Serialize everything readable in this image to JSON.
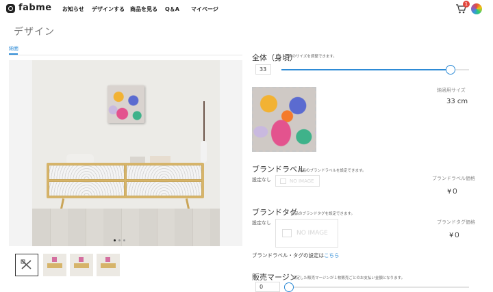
{
  "header": {
    "logo": "fabme",
    "nav": [
      "お知らせ",
      "デザインする",
      "商品を見る",
      "Q＆A",
      "マイページ"
    ],
    "cart_count": "1"
  },
  "page": {
    "title": "デザイン",
    "tab": "納面"
  },
  "preview": {
    "slide_count": 3,
    "active_slide": 1
  },
  "size_section": {
    "title": "全体（身頃）",
    "hint": "柄のサイズを調整できます。",
    "value": "33",
    "slider_fraction": 0.9,
    "size_label": "納適用サイズ",
    "size_value": "33 cm"
  },
  "brand_label": {
    "title": "ブランドラベル",
    "hint": "商品のブランドラベルを設定できます。",
    "status": "設定なし",
    "no_image": "NO IMAGE",
    "price_label": "ブランドラベル価格",
    "price": "¥０"
  },
  "brand_tag": {
    "title": "ブランドタグ",
    "hint": "商品のブランドタグを設定できます。",
    "status": "設定なし",
    "no_image": "NO IMAGE",
    "price_label": "ブランドタグ価格",
    "price": "¥０",
    "settings_text": "ブランドラベル・タグの設定は",
    "settings_link": "こちら"
  },
  "margin": {
    "title": "販売マージン",
    "hint": "設定した販売マージンが１枚販売ごとのお支払い金額となります。",
    "value": "0",
    "slider_fraction": 0.0
  },
  "colors": {
    "accent": "#2e8bd6",
    "badge": "#e2453c"
  }
}
